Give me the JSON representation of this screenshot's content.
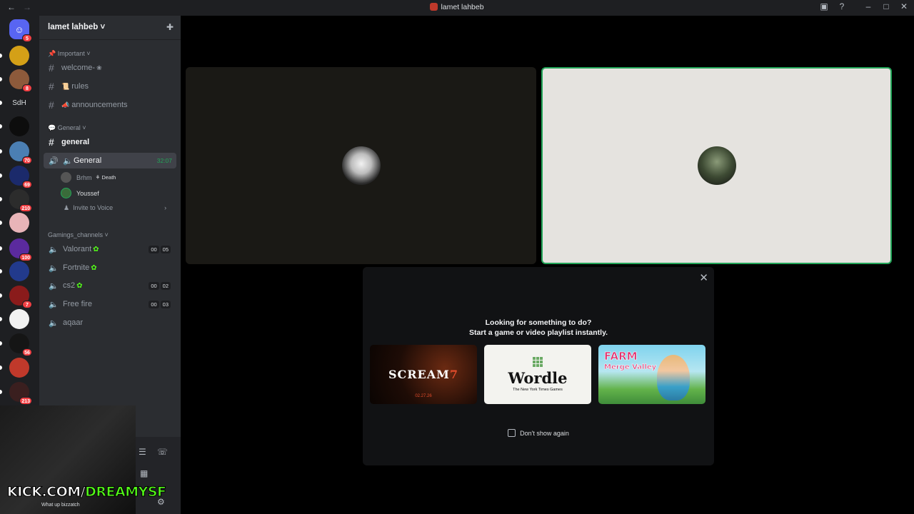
{
  "window": {
    "title": "lamet lahbeb"
  },
  "rail": {
    "servers": [
      {
        "name": "discord-home",
        "badge": "5",
        "color": "#5865f2",
        "label": ""
      },
      {
        "name": "server-1",
        "badge": "",
        "color": "#d4a017",
        "label": ""
      },
      {
        "name": "server-2",
        "badge": "8",
        "color": "#8d5a3b",
        "label": ""
      },
      {
        "name": "server-sdh",
        "badge": "",
        "color": "#1e1f22",
        "label": "SdH"
      },
      {
        "name": "server-4",
        "badge": "",
        "color": "#0d0d0d",
        "label": ""
      },
      {
        "name": "server-5",
        "badge": "70",
        "color": "#4b7fb3",
        "label": ""
      },
      {
        "name": "server-6",
        "badge": "69",
        "color": "#1b2a6b",
        "label": ""
      },
      {
        "name": "server-7",
        "badge": "210",
        "color": "#2c2c2c",
        "label": ""
      },
      {
        "name": "server-8",
        "badge": "",
        "color": "#e8b4b8",
        "label": ""
      },
      {
        "name": "server-9",
        "badge": "100",
        "color": "#5b2a9e",
        "label": ""
      },
      {
        "name": "server-10",
        "badge": "",
        "color": "#223a8c",
        "label": ""
      },
      {
        "name": "server-11",
        "badge": "7",
        "color": "#8a1b1b",
        "label": ""
      },
      {
        "name": "server-12",
        "badge": "",
        "color": "#f2f2f2",
        "label": ""
      },
      {
        "name": "server-13",
        "badge": "56",
        "color": "#151515",
        "label": ""
      },
      {
        "name": "server-14",
        "badge": "",
        "color": "#c0392b",
        "label": ""
      },
      {
        "name": "server-15",
        "badge": "213",
        "color": "#3a1f1f",
        "label": ""
      }
    ]
  },
  "sidebar": {
    "guild_name": "lamet lahbeb",
    "categories": {
      "important": "Important",
      "general": "General",
      "gaming": "Gamings_channels"
    },
    "channels": {
      "welcome": "welcome-",
      "rules": "rules",
      "announcements": "announcements",
      "general_text": "general",
      "general_voice": "General",
      "general_voice_timer": "32:07",
      "valorant": "Valorant",
      "valorant_counts": [
        "00",
        "05"
      ],
      "fortnite": "Fortnite",
      "cs2": "cs2",
      "cs2_counts": [
        "00",
        "02"
      ],
      "freefire": "Free fire",
      "freefire_counts": [
        "00",
        "03"
      ],
      "aqaar": "aqaar"
    },
    "voice_users": [
      {
        "name": "Brhm",
        "status": "Death"
      },
      {
        "name": "Youssef",
        "status": ""
      }
    ],
    "invite_label": "Invite to Voice"
  },
  "overlay": {
    "kick_prefix": "KICK.COM/",
    "kick_user": "DREAMYSF",
    "custom_status": "What up bizzatch"
  },
  "popup": {
    "title_line1": "Looking for something to do?",
    "title_line2": "Start a game or video playlist instantly.",
    "cards": {
      "scream": "SCREAM",
      "scream_num": "7",
      "scream_date": "02.27.26",
      "wordle": "Wordle",
      "wordle_sub": "The New York Times Games",
      "farm": "FARM",
      "farm_sub": "Merge Valley"
    },
    "checkbox_label": "Don't show again"
  },
  "colors": {
    "accent_green": "#23a559",
    "kick_green": "#53fc18",
    "badge_red": "#f23f43"
  }
}
